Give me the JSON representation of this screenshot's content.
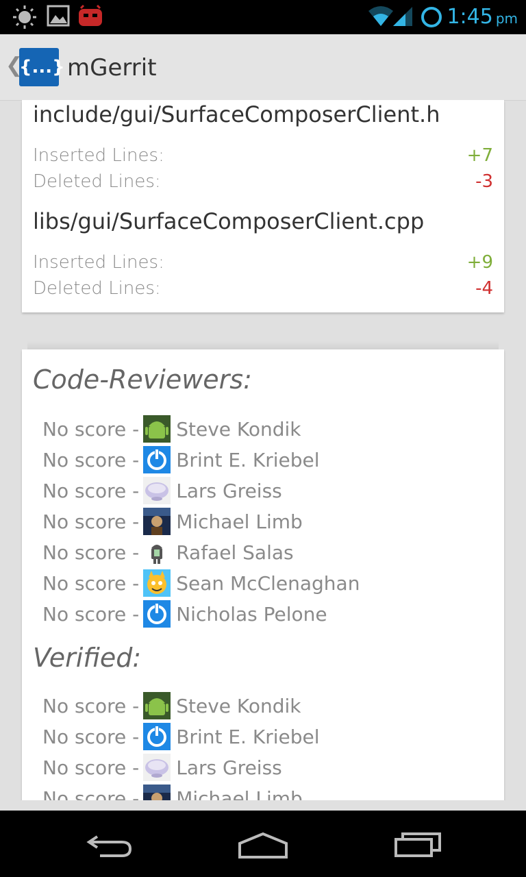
{
  "status_bar": {
    "time": "1:45",
    "ampm": "pm",
    "icons": [
      "brightness-icon",
      "image-icon",
      "cyanogenmod-icon",
      "wifi-icon",
      "signal-icon",
      "sync-icon"
    ]
  },
  "action_bar": {
    "app_name": "mGerrit",
    "logo_text": "{...}"
  },
  "files": [
    {
      "name": "include/gui/SurfaceComposerClient.h",
      "inserted_label": "Inserted Lines:",
      "inserted": "+7",
      "deleted_label": "Deleted Lines:",
      "deleted": "-3"
    },
    {
      "name": "libs/gui/SurfaceComposerClient.cpp",
      "inserted_label": "Inserted Lines:",
      "inserted": "+9",
      "deleted_label": "Deleted Lines:",
      "deleted": "-4"
    }
  ],
  "reviewers": {
    "code_title": "Code-Reviewers:",
    "verified_title": "Verified:",
    "code": [
      {
        "score": "No score -",
        "name": "Steve Kondik",
        "avatar": "android-avatar"
      },
      {
        "score": "No score -",
        "name": "Brint E. Kriebel",
        "avatar": "power-avatar"
      },
      {
        "score": "No score -",
        "name": "Lars Greiss",
        "avatar": "bowl-avatar"
      },
      {
        "score": "No score -",
        "name": "Michael Limb",
        "avatar": "photo-avatar"
      },
      {
        "score": "No score -",
        "name": "Rafael Salas",
        "avatar": "android-small-avatar"
      },
      {
        "score": "No score -",
        "name": "Sean McClenaghan",
        "avatar": "cartoon-avatar"
      },
      {
        "score": "No score -",
        "name": "Nicholas Pelone",
        "avatar": "power-avatar"
      }
    ],
    "verified": [
      {
        "score": "No score -",
        "name": "Steve Kondik",
        "avatar": "android-avatar"
      },
      {
        "score": "No score -",
        "name": "Brint E. Kriebel",
        "avatar": "power-avatar"
      },
      {
        "score": "No score -",
        "name": "Lars Greiss",
        "avatar": "bowl-avatar"
      },
      {
        "score": "No score -",
        "name": "Michael Limb",
        "avatar": "photo-avatar"
      }
    ]
  },
  "colors": {
    "accent": "#33b5e5",
    "inserted": "#7fae3a",
    "deleted": "#d03030",
    "logo": "#1565b4"
  },
  "nav_bar": {
    "buttons": [
      "back-icon",
      "home-icon",
      "recents-icon"
    ]
  }
}
